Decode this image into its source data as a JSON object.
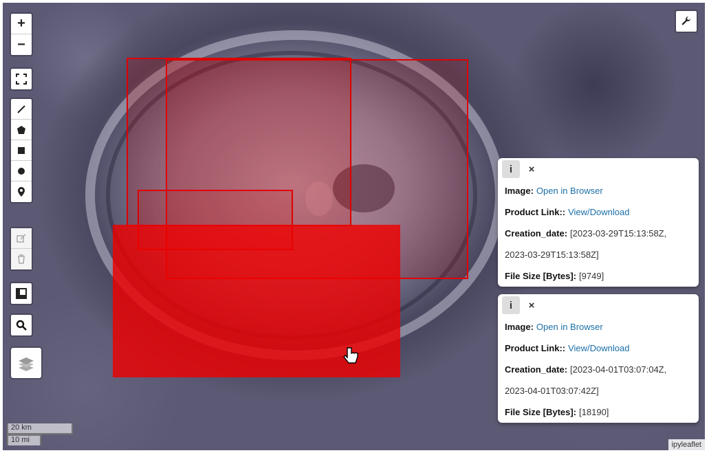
{
  "map": {
    "zoom_in": "+",
    "zoom_out": "−",
    "attribution": "ipyleaflet",
    "scale_metric": "20 km",
    "scale_imperial": "10 mi",
    "footprint_color": "#ff0000"
  },
  "controls": {
    "zoom_in_icon": "plus-icon",
    "zoom_out_icon": "minus-icon",
    "fullscreen_icon": "fullscreen-icon",
    "draw_tools": [
      "polyline-icon",
      "polygon-icon",
      "rectangle-icon",
      "circle-icon",
      "marker-icon"
    ],
    "edit_tools": [
      "edit-icon",
      "trash-icon"
    ],
    "split_map_icon": "split-map-icon",
    "search_icon": "search-icon",
    "layers_icon": "layers-icon",
    "settings_icon": "wrench-icon"
  },
  "popups": [
    {
      "info_tab": "i",
      "close": "×",
      "image_label": "Image:",
      "image_link": "Open in Browser",
      "product_label": "Product Link::",
      "product_link": "View/Download",
      "creation_label": "Creation_date:",
      "creation_line1": "[2023-03-29T15:13:58Z,",
      "creation_line2": "2023-03-29T15:13:58Z]",
      "size_label": "File Size [Bytes]:",
      "size_value": "[9749]"
    },
    {
      "info_tab": "i",
      "close": "×",
      "image_label": "Image:",
      "image_link": "Open in Browser",
      "product_label": "Product Link::",
      "product_link": "View/Download",
      "creation_label": "Creation_date:",
      "creation_line1": "[2023-04-01T03:07:04Z,",
      "creation_line2": "2023-04-01T03:07:42Z]",
      "size_label": "File Size [Bytes]:",
      "size_value": "[18190]"
    }
  ]
}
